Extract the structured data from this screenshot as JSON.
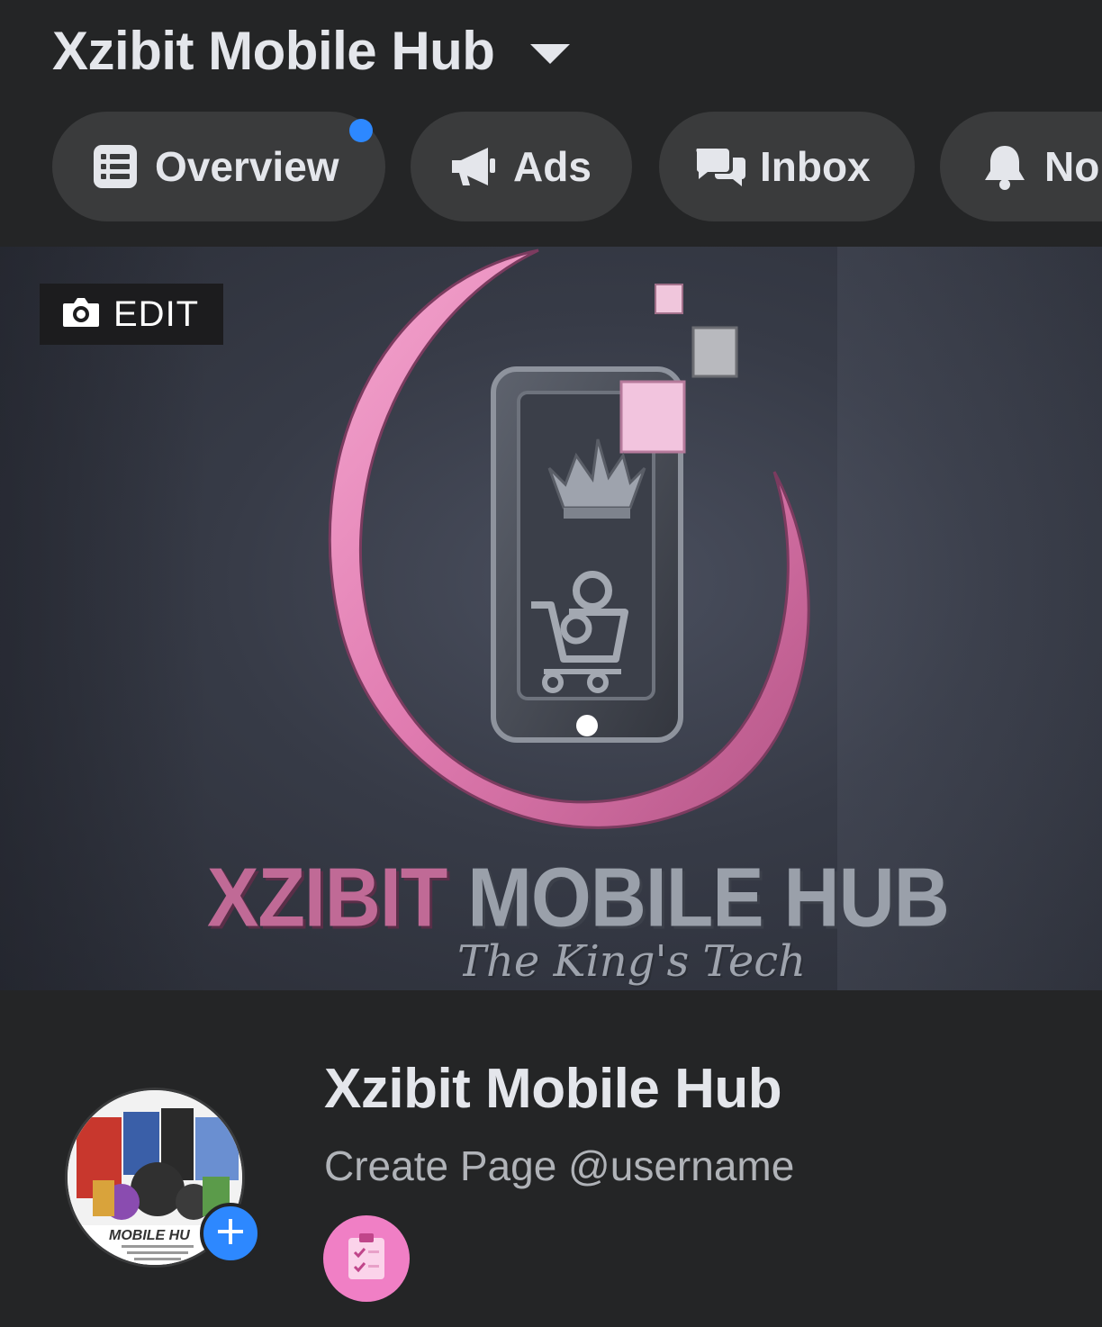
{
  "header": {
    "page_title": "Xzibit Mobile Hub",
    "tabs": [
      {
        "label": "Overview",
        "icon": "list-icon",
        "has_notification_dot": true
      },
      {
        "label": "Ads",
        "icon": "megaphone-icon"
      },
      {
        "label": "Inbox",
        "icon": "chat-bubbles-icon"
      },
      {
        "label": "No",
        "icon": "bell-icon"
      }
    ]
  },
  "cover": {
    "edit_label": "EDIT",
    "edit_icon": "camera-icon",
    "brand_word1": "XZIBIT",
    "brand_word2": "MOBILE HUB",
    "tagline": "The King's Tech"
  },
  "profile": {
    "name": "Xzibit Mobile Hub",
    "username_prompt": "Create Page @username",
    "avatar_text": "MOBILE HU",
    "add_icon": "plus-icon",
    "action_icon": "clipboard-checklist-icon"
  },
  "colors": {
    "background": "#242526",
    "pill": "#3a3b3c",
    "accent_blue": "#2d88ff",
    "brand_pink": "#e07bb0"
  }
}
